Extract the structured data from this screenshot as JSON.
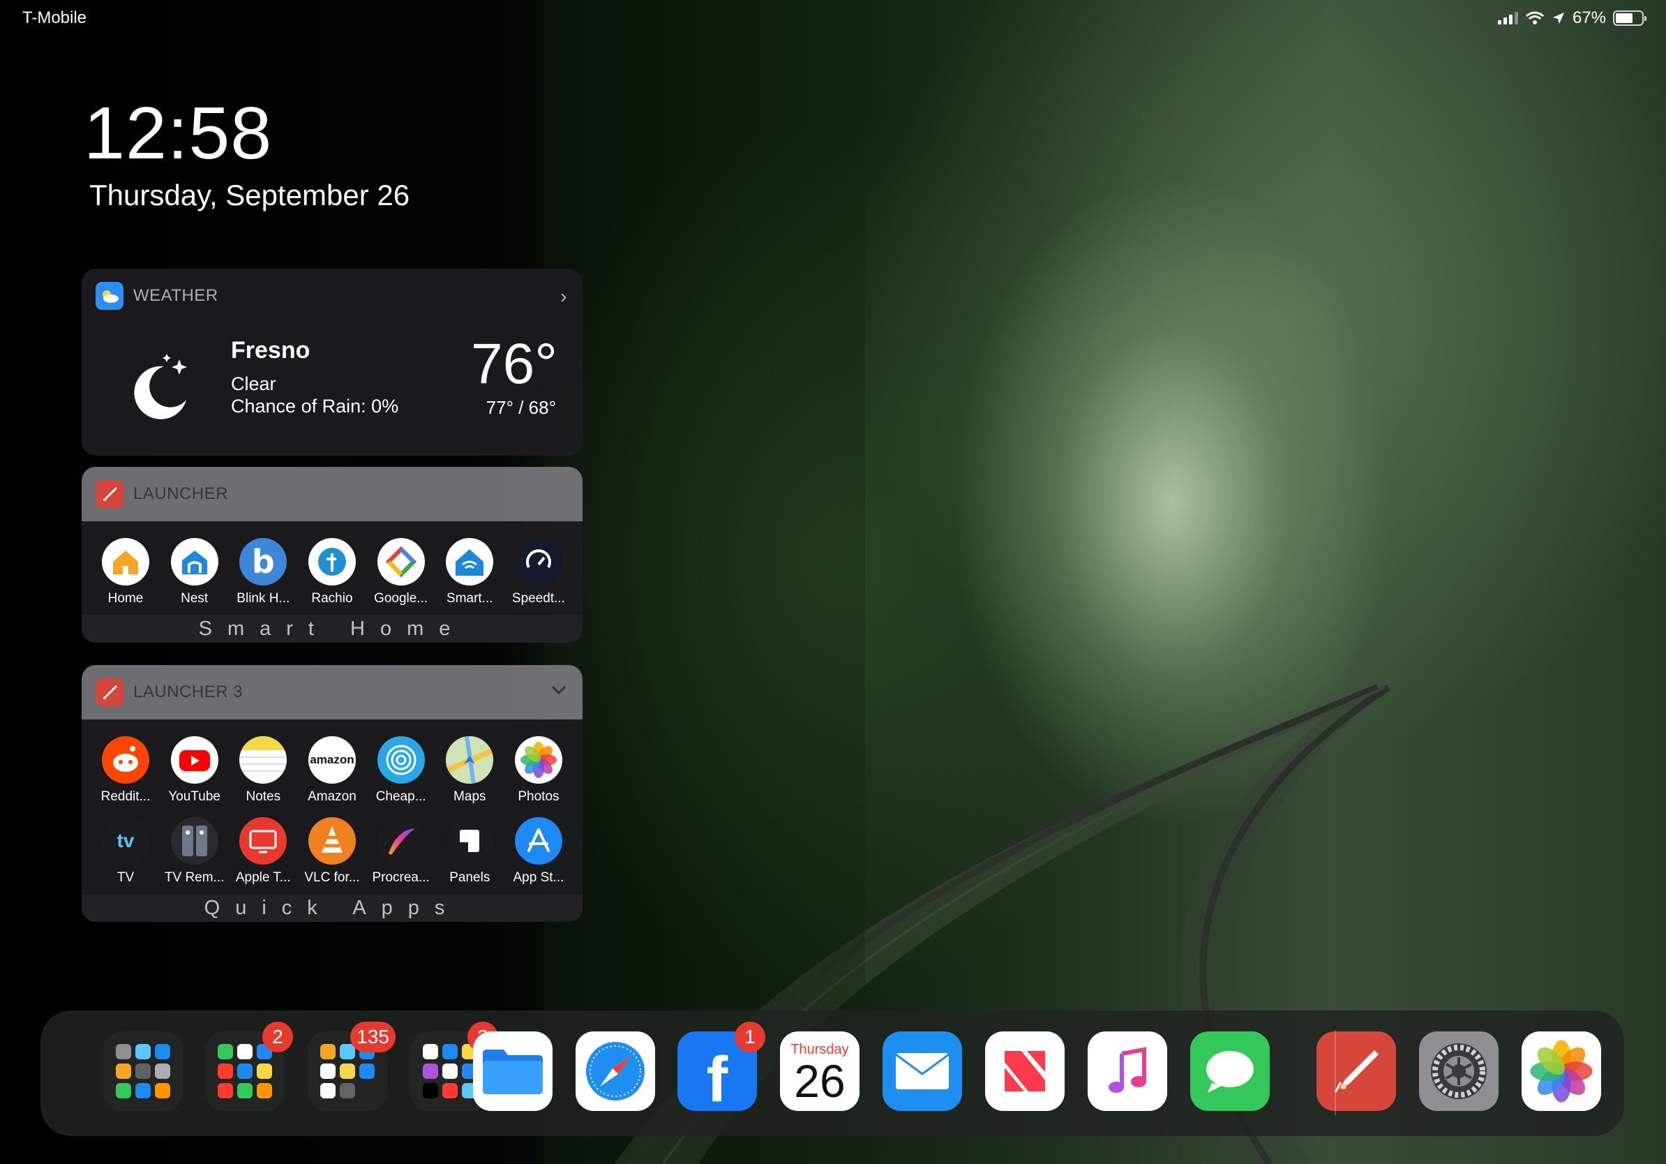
{
  "status_bar": {
    "carrier": "T-Mobile",
    "battery_percent": "67%",
    "battery_level": 0.67
  },
  "lock": {
    "time": "12:58",
    "date": "Thursday, September 26"
  },
  "weather_widget": {
    "title": "WEATHER",
    "city": "Fresno",
    "condition": "Clear",
    "rain": "Chance of Rain: 0%",
    "temp": "76°",
    "hilo": "77° / 68°",
    "icon": "moon-icon"
  },
  "launcher1": {
    "title": "LAUNCHER",
    "footer": "Smart Home",
    "apps": [
      {
        "label": "Home",
        "icon": "home-icon",
        "color": "#ffffff"
      },
      {
        "label": "Nest",
        "icon": "nest-icon",
        "color": "#ffffff"
      },
      {
        "label": "Blink H...",
        "icon": "blink-icon",
        "color": "#3d87d8"
      },
      {
        "label": "Rachio",
        "icon": "rachio-icon",
        "color": "#ffffff"
      },
      {
        "label": "Google...",
        "icon": "google-home-icon",
        "color": "#ffffff"
      },
      {
        "label": "Smart...",
        "icon": "smart-home-icon",
        "color": "#ffffff"
      },
      {
        "label": "Speedt...",
        "icon": "speedtest-icon",
        "color": "#141a2b"
      }
    ]
  },
  "launcher3": {
    "title": "LAUNCHER 3",
    "footer": "Quick Apps",
    "apps_row1": [
      {
        "label": "Reddit...",
        "icon": "reddit-icon",
        "color": "#ff4500"
      },
      {
        "label": "YouTube",
        "icon": "youtube-icon",
        "color": "#ffffff"
      },
      {
        "label": "Notes",
        "icon": "notes-icon",
        "color": "#ffffff"
      },
      {
        "label": "Amazon",
        "icon": "amazon-icon",
        "color": "#ffffff"
      },
      {
        "label": "Cheap...",
        "icon": "cheap-icon",
        "color": "#29a8e8"
      },
      {
        "label": "Maps",
        "icon": "maps-icon",
        "color": "#dfe8d0"
      },
      {
        "label": "Photos",
        "icon": "photos-icon",
        "color": "#ffffff"
      }
    ],
    "apps_row2": [
      {
        "label": "TV",
        "icon": "tv-icon",
        "color": "#1c1c1e"
      },
      {
        "label": "TV Rem...",
        "icon": "tv-remote-icon",
        "color": "#2a2a2e"
      },
      {
        "label": "Apple T...",
        "icon": "apple-t-icon",
        "color": "#e8392e"
      },
      {
        "label": "VLC for...",
        "icon": "vlc-icon",
        "color": "#f08020"
      },
      {
        "label": "Procrea...",
        "icon": "procreate-icon",
        "color": "#1c1c1e"
      },
      {
        "label": "Panels",
        "icon": "panels-icon",
        "color": "#1c1c1e"
      },
      {
        "label": "App St...",
        "icon": "app-store-icon",
        "color": "#1d8af4"
      }
    ]
  },
  "dock": {
    "folders": [
      {
        "name": "folder-1",
        "badge": ""
      },
      {
        "name": "folder-2",
        "badge": "2"
      },
      {
        "name": "folder-3",
        "badge": "135"
      },
      {
        "name": "folder-4",
        "badge": "2"
      }
    ],
    "apps": [
      {
        "name": "files-icon",
        "badge": ""
      },
      {
        "name": "safari-icon",
        "badge": ""
      },
      {
        "name": "facebook-icon",
        "badge": "1"
      },
      {
        "name": "calendar-icon",
        "badge": "",
        "day_name": "Thursday",
        "day_num": "26"
      },
      {
        "name": "mail-icon",
        "badge": ""
      },
      {
        "name": "news-icon",
        "badge": ""
      },
      {
        "name": "music-icon",
        "badge": ""
      },
      {
        "name": "messages-icon",
        "badge": ""
      },
      {
        "name": "launcher-icon",
        "badge": ""
      },
      {
        "name": "settings-icon",
        "badge": ""
      },
      {
        "name": "photos-icon",
        "badge": ""
      }
    ]
  }
}
